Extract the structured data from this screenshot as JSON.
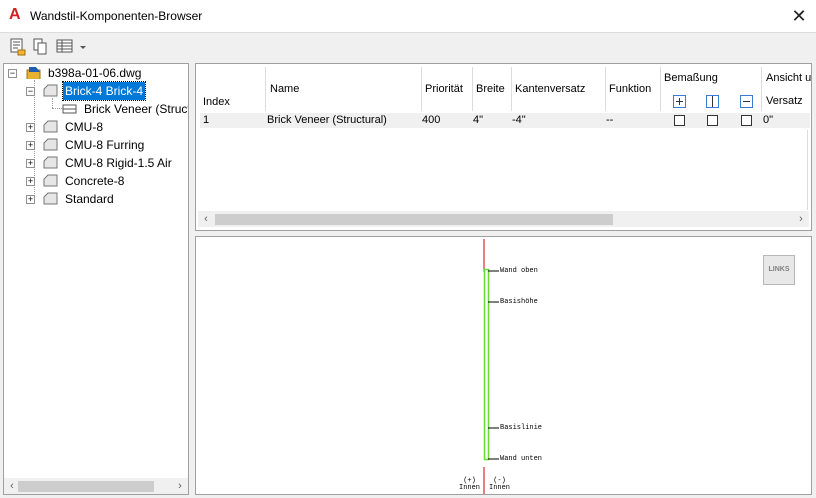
{
  "window": {
    "title": "Wandstil-Komponenten-Browser",
    "close_glyph": "✕"
  },
  "toolbar": {
    "icons": [
      "list-properties-icon",
      "copy-icon",
      "table-view-icon",
      "dropdown-arrow-icon"
    ]
  },
  "tree": {
    "root": "b398a-01-06.dwg",
    "items": [
      {
        "label": "Brick-4 Brick-4",
        "selected": true,
        "expanded": true
      },
      {
        "label": "Brick Veneer (Struct",
        "child": true
      },
      {
        "label": "CMU-8"
      },
      {
        "label": "CMU-8 Furring"
      },
      {
        "label": "CMU-8 Rigid-1.5 Air"
      },
      {
        "label": "Concrete-8"
      },
      {
        "label": "Standard"
      }
    ]
  },
  "table": {
    "headers": {
      "index": "Index",
      "name": "Name",
      "prioritaet": "Priorität",
      "breite": "Breite",
      "kantenversatz": "Kantenversatz",
      "funktion": "Funktion",
      "bemassung": "Bemaßung",
      "ansicht": "Ansicht u",
      "versatz": "Versatz"
    },
    "rows": [
      {
        "index": "1",
        "name": "Brick Veneer (Structural)",
        "prioritaet": "400",
        "breite": "4\"",
        "kantenversatz": "-4\"",
        "funktion": "--",
        "versatz": "0\""
      }
    ]
  },
  "preview": {
    "links_button": "LINKS",
    "labels": {
      "wand_oben": "Wand oben",
      "basishoehe": "Basishöhe",
      "basislinie": "Basislinie",
      "wand_unten": "Wand unten",
      "innen_left": "(+)\nInnen",
      "innen_right": "(-)\nInnen"
    },
    "colors": {
      "axis": "#d00000",
      "component": "#66dd33"
    }
  }
}
